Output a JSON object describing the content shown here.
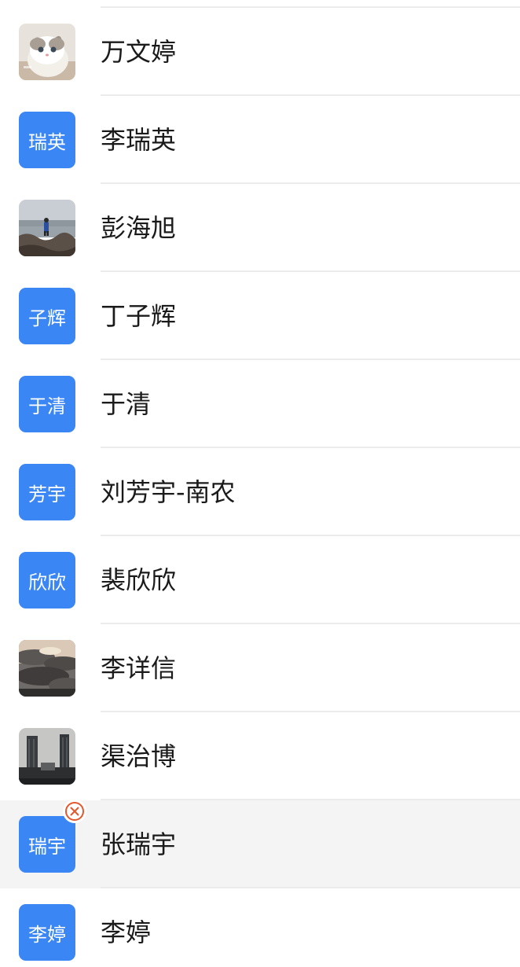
{
  "contacts": [
    {
      "name": "万文婷",
      "avatar_text": "",
      "avatar_image": "kitten photo"
    },
    {
      "name": "李瑞英",
      "avatar_text": "瑞英",
      "avatar_image": ""
    },
    {
      "name": "彭海旭",
      "avatar_text": "",
      "avatar_image": "person on seaside rocks photo"
    },
    {
      "name": "丁子辉",
      "avatar_text": "子辉",
      "avatar_image": ""
    },
    {
      "name": "于清",
      "avatar_text": "于清",
      "avatar_image": ""
    },
    {
      "name": "刘芳宇-南农",
      "avatar_text": "芳宇",
      "avatar_image": ""
    },
    {
      "name": "裴欣欣",
      "avatar_text": "欣欣",
      "avatar_image": ""
    },
    {
      "name": "李详信",
      "avatar_text": "",
      "avatar_image": "cloudy sky photo"
    },
    {
      "name": "渠治博",
      "avatar_text": "",
      "avatar_image": "city buildings photo"
    },
    {
      "name": "张瑞宇",
      "avatar_text": "瑞宇",
      "avatar_image": "",
      "selected": true
    },
    {
      "name": "李婷",
      "avatar_text": "李婷",
      "avatar_image": ""
    }
  ],
  "icons": {
    "remove": "remove-circle-icon"
  },
  "colors": {
    "avatar_blue": "#3a86f5",
    "remove_orange": "#e2572b",
    "selected_row": "#f4f4f4",
    "divider": "#ececec",
    "name_text": "#1a1a1a"
  }
}
